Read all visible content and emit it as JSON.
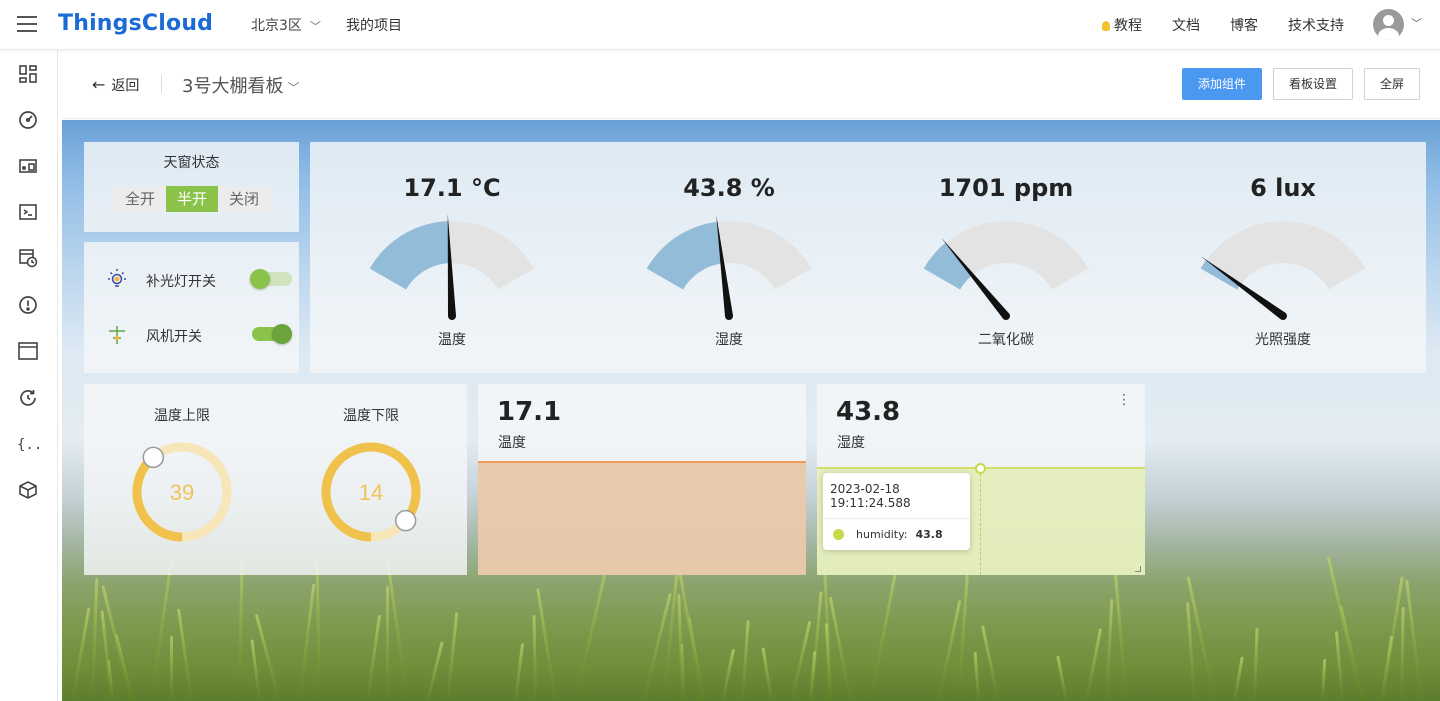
{
  "header": {
    "brand": "ThingsCloud",
    "region": "北京3区",
    "my_projects": "我的项目",
    "links": [
      "教程",
      "文档",
      "博客",
      "技术支持"
    ]
  },
  "sidebar": {
    "icons": [
      "dashboard-icon",
      "gauge-icon",
      "devices-icon",
      "terminal-icon",
      "rules-icon",
      "alert-icon",
      "window-icon",
      "history-icon",
      "code-braces-icon",
      "package-icon"
    ]
  },
  "toolbar": {
    "back_label": "返回",
    "board_title": "3号大棚看板",
    "add_widget": "添加组件",
    "board_settings": "看板设置",
    "fullscreen": "全屏"
  },
  "skylight": {
    "title": "天窗状态",
    "options": [
      "全开",
      "半开",
      "关闭"
    ],
    "selected": "半开"
  },
  "switches": [
    {
      "label": "补光灯开关",
      "on": false
    },
    {
      "label": "风机开关",
      "on": true
    }
  ],
  "gauges": [
    {
      "value_text": "17.1 °C",
      "label": "温度",
      "fraction": 0.48
    },
    {
      "value_text": "43.8 %",
      "label": "湿度",
      "fraction": 0.44
    },
    {
      "value_text": "1701 ppm",
      "label": "二氧化碳",
      "fraction": 0.17
    },
    {
      "value_text": "6 lux",
      "label": "光照强度",
      "fraction": 0.05
    }
  ],
  "limits": [
    {
      "label": "温度上限",
      "value": "39",
      "fraction": 0.39
    },
    {
      "label": "温度下限",
      "value": "14",
      "fraction": 0.86
    }
  ],
  "temp_chart": {
    "value": "17.1",
    "label": "温度"
  },
  "humidity_chart": {
    "value": "43.8",
    "label": "湿度",
    "tooltip_time": "2023-02-18 19:11:24.588",
    "tooltip_series": "humidity:",
    "tooltip_value": "43.8"
  },
  "colors": {
    "accent": "#4a98f0",
    "brand": "#1a6bd6",
    "green": "#8bc34a",
    "gauge_fill": "#93bcd9",
    "gauge_track": "#e3e3e3",
    "knob_arc": "#f0c24c"
  }
}
